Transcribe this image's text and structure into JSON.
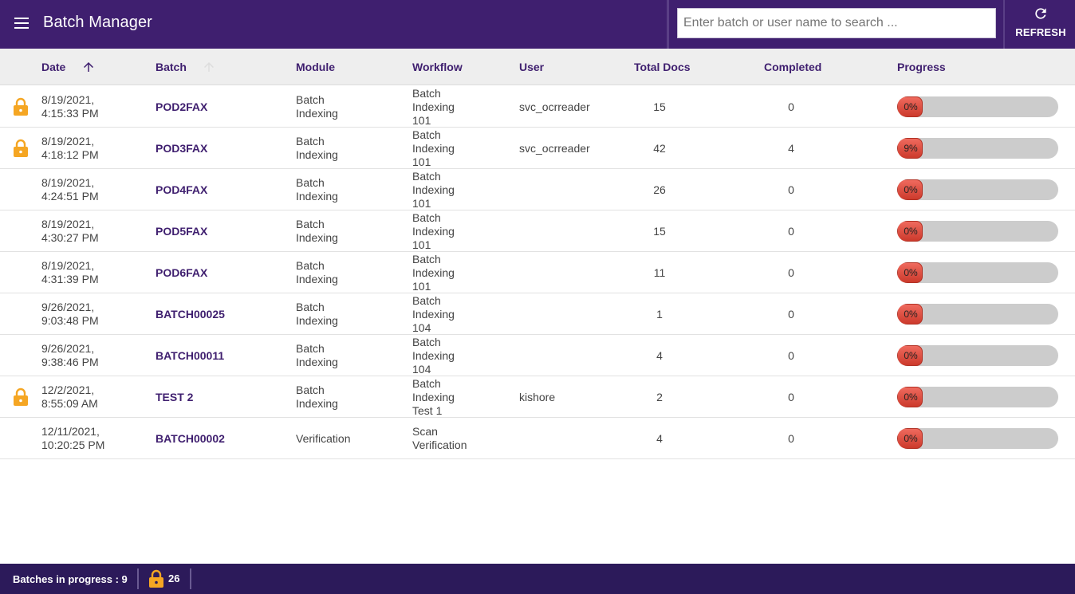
{
  "header": {
    "title": "Batch Manager",
    "search_placeholder": "Enter batch or user name to search ...",
    "search_value": "",
    "refresh_label": "REFRESH"
  },
  "columns": {
    "date": "Date",
    "batch": "Batch",
    "module": "Module",
    "workflow": "Workflow",
    "user": "User",
    "total_docs": "Total Docs",
    "completed": "Completed",
    "progress": "Progress"
  },
  "rows": [
    {
      "locked": true,
      "date1": "8/19/2021,",
      "date2": "4:15:33 PM",
      "batch": "POD2FAX",
      "module1": "Batch",
      "module2": "Indexing",
      "workflow1": "Batch",
      "workflow2": "Indexing",
      "workflow3": "101",
      "user": "svc_ocrreader",
      "total": "15",
      "completed": "0",
      "progress_label": "0%",
      "progress_value": 0
    },
    {
      "locked": true,
      "date1": "8/19/2021,",
      "date2": "4:18:12 PM",
      "batch": "POD3FAX",
      "module1": "Batch",
      "module2": "Indexing",
      "workflow1": "Batch",
      "workflow2": "Indexing",
      "workflow3": "101",
      "user": "svc_ocrreader",
      "total": "42",
      "completed": "4",
      "progress_label": "9%",
      "progress_value": 9
    },
    {
      "locked": false,
      "date1": "8/19/2021,",
      "date2": "4:24:51 PM",
      "batch": "POD4FAX",
      "module1": "Batch",
      "module2": "Indexing",
      "workflow1": "Batch",
      "workflow2": "Indexing",
      "workflow3": "101",
      "user": "",
      "total": "26",
      "completed": "0",
      "progress_label": "0%",
      "progress_value": 0
    },
    {
      "locked": false,
      "date1": "8/19/2021,",
      "date2": "4:30:27 PM",
      "batch": "POD5FAX",
      "module1": "Batch",
      "module2": "Indexing",
      "workflow1": "Batch",
      "workflow2": "Indexing",
      "workflow3": "101",
      "user": "",
      "total": "15",
      "completed": "0",
      "progress_label": "0%",
      "progress_value": 0
    },
    {
      "locked": false,
      "date1": "8/19/2021,",
      "date2": "4:31:39 PM",
      "batch": "POD6FAX",
      "module1": "Batch",
      "module2": "Indexing",
      "workflow1": "Batch",
      "workflow2": "Indexing",
      "workflow3": "101",
      "user": "",
      "total": "11",
      "completed": "0",
      "progress_label": "0%",
      "progress_value": 0
    },
    {
      "locked": false,
      "date1": "9/26/2021,",
      "date2": "9:03:48 PM",
      "batch": "BATCH00025",
      "module1": "Batch",
      "module2": "Indexing",
      "workflow1": "Batch",
      "workflow2": "Indexing",
      "workflow3": "104",
      "user": "",
      "total": "1",
      "completed": "0",
      "progress_label": "0%",
      "progress_value": 0
    },
    {
      "locked": false,
      "date1": "9/26/2021,",
      "date2": "9:38:46 PM",
      "batch": "BATCH00011",
      "module1": "Batch",
      "module2": "Indexing",
      "workflow1": "Batch",
      "workflow2": "Indexing",
      "workflow3": "104",
      "user": "",
      "total": "4",
      "completed": "0",
      "progress_label": "0%",
      "progress_value": 0
    },
    {
      "locked": true,
      "date1": "12/2/2021,",
      "date2": "8:55:09 AM",
      "batch": "TEST 2",
      "module1": "Batch",
      "module2": "Indexing",
      "workflow1": "Batch",
      "workflow2": "Indexing",
      "workflow3": "Test 1",
      "user": "kishore",
      "total": "2",
      "completed": "0",
      "progress_label": "0%",
      "progress_value": 0
    },
    {
      "locked": false,
      "date1": "12/11/2021,",
      "date2": "10:20:25 PM",
      "batch": "BATCH00002",
      "module1": "Verification",
      "module2": "",
      "workflow1": "Scan",
      "workflow2": "Verification",
      "workflow3": "",
      "user": "",
      "total": "4",
      "completed": "0",
      "progress_label": "0%",
      "progress_value": 0
    }
  ],
  "footer": {
    "in_progress_label": "Batches in progress : 9",
    "locked_count": "26"
  },
  "colors": {
    "primary": "#3f1f6f",
    "footer": "#2c1a5a",
    "lock": "#f5a623",
    "progress_fill": "#e0493c",
    "progress_track": "#cccccc"
  },
  "icons": {
    "menu": "hamburger-menu-icon",
    "refresh": "refresh-icon",
    "sort": "arrow-up-icon",
    "lock": "lock-icon"
  }
}
